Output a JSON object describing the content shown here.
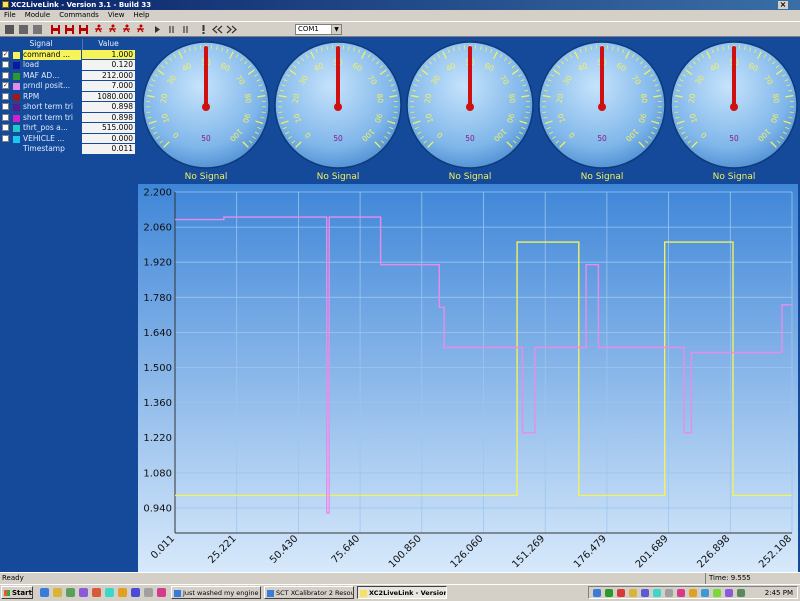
{
  "window": {
    "title": "XC2LiveLink - Version 3.1 - Build 33",
    "close": "×"
  },
  "menu": [
    "File",
    "Module",
    "Commands",
    "View",
    "Help"
  ],
  "toolbar": {
    "icons": [
      "stop-icon",
      "stop-icon",
      "stop-icon",
      "record-icon",
      "record-icon",
      "record-icon",
      "runner-icon",
      "runner-icon",
      "runner-icon",
      "runner-icon",
      "play-icon",
      "pause-icon",
      "pause-icon",
      "exclamation-icon",
      "rewind-icon",
      "fast-forward-icon"
    ],
    "port_select": "COM1"
  },
  "signals": {
    "header": {
      "signal": "Signal",
      "value": "Value"
    },
    "rows": [
      {
        "name": "command ...",
        "value": "1.000",
        "checked": true,
        "color": "#f7f35a",
        "selected": true
      },
      {
        "name": "load",
        "value": "0.120",
        "checked": false,
        "color": "#0a1aa0"
      },
      {
        "name": "MAF AD...",
        "value": "212.000",
        "checked": false,
        "color": "#2a9a2a"
      },
      {
        "name": "prndl posit...",
        "value": "7.000",
        "checked": true,
        "color": "#e38be8"
      },
      {
        "name": "RPM",
        "value": "1080.000",
        "checked": false,
        "color": "#a01818"
      },
      {
        "name": "short term tri",
        "value": "0.898",
        "checked": false,
        "color": "#5a1a8a"
      },
      {
        "name": "short term tri",
        "value": "0.898",
        "checked": false,
        "color": "#d020d0"
      },
      {
        "name": "thrt_pos a...",
        "value": "515.000",
        "checked": false,
        "color": "#20c8c8"
      },
      {
        "name": "VEHICLE ...",
        "value": "0.000",
        "checked": false,
        "color": "#18c8f0"
      }
    ],
    "timestamp": {
      "name": "Timestamp",
      "value": "0.011"
    }
  },
  "gauges": {
    "count": 5,
    "labels": [
      "0",
      "10",
      "20",
      "30",
      "40",
      "50",
      "60",
      "70",
      "80",
      "90",
      "100"
    ],
    "center_label": "50",
    "status": "No Signal",
    "needle_value": 50,
    "range": [
      0,
      100
    ]
  },
  "chart_data": {
    "type": "line",
    "xlim": [
      0.011,
      252.108
    ],
    "ylim": [
      0.84,
      2.2
    ],
    "x_ticks": [
      "0.011",
      "25.221",
      "50.430",
      "75.640",
      "100.850",
      "126.060",
      "151.269",
      "176.479",
      "201.689",
      "226.898",
      "252.108"
    ],
    "y_ticks": [
      "0.940",
      "1.080",
      "1.220",
      "1.360",
      "1.500",
      "1.640",
      "1.780",
      "1.920",
      "2.060",
      "2.200"
    ],
    "grid": true,
    "series": [
      {
        "color": "#f2f25a",
        "points": [
          [
            0.011,
            0.99
          ],
          [
            139.8,
            0.99
          ],
          [
            139.8,
            2.0
          ],
          [
            165.0,
            2.0
          ],
          [
            165.0,
            0.99
          ],
          [
            200.1,
            0.99
          ],
          [
            200.1,
            2.0
          ],
          [
            228.0,
            2.0
          ],
          [
            228.0,
            0.99
          ],
          [
            252.1,
            0.99
          ]
        ]
      },
      {
        "color": "#e98ce9",
        "points": [
          [
            0.011,
            2.09
          ],
          [
            20.0,
            2.09
          ],
          [
            20.0,
            2.1
          ],
          [
            62.0,
            2.1
          ],
          [
            62.0,
            0.92
          ],
          [
            63.0,
            0.92
          ],
          [
            63.0,
            2.1
          ],
          [
            84.0,
            2.1
          ],
          [
            84.0,
            1.91
          ],
          [
            108.0,
            1.91
          ],
          [
            108.0,
            1.74
          ],
          [
            110.0,
            1.74
          ],
          [
            110.0,
            1.58
          ],
          [
            142.0,
            1.58
          ],
          [
            142.0,
            1.24
          ],
          [
            147.0,
            1.24
          ],
          [
            147.0,
            1.58
          ],
          [
            168.0,
            1.58
          ],
          [
            168.0,
            1.91
          ],
          [
            173.0,
            1.91
          ],
          [
            173.0,
            1.58
          ],
          [
            208.0,
            1.58
          ],
          [
            208.0,
            1.24
          ],
          [
            211.0,
            1.24
          ],
          [
            211.0,
            1.56
          ],
          [
            248.0,
            1.56
          ],
          [
            248.0,
            1.75
          ],
          [
            252.1,
            1.75
          ]
        ]
      }
    ]
  },
  "status": {
    "text": "Ready",
    "time": "Time: 9.555"
  },
  "taskbar": {
    "start": "Start",
    "tasks": [
      "Just washed my engine - ...",
      "SCT XCalibrator 2 Resour...",
      "XC2LiveLink - Version ..."
    ],
    "clock": "2:45 PM"
  }
}
